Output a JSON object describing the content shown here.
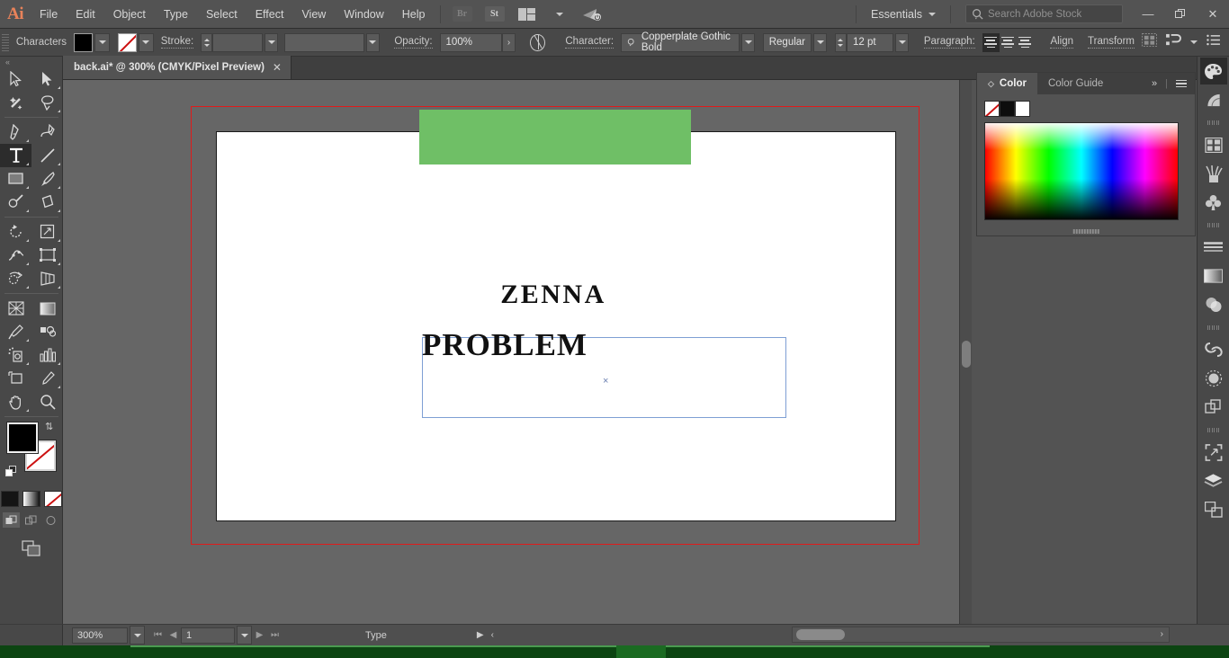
{
  "app": {
    "name": "Adobe Illustrator",
    "logo": "Ai"
  },
  "menubar": {
    "items": [
      {
        "label": "File"
      },
      {
        "label": "Edit"
      },
      {
        "label": "Object"
      },
      {
        "label": "Type"
      },
      {
        "label": "Select"
      },
      {
        "label": "Effect"
      },
      {
        "label": "View"
      },
      {
        "label": "Window"
      },
      {
        "label": "Help"
      }
    ],
    "bridge_label": "Br",
    "stock_label": "St",
    "workspace": "Essentials",
    "search_placeholder": "Search Adobe Stock",
    "window_controls": {
      "minimize": "—",
      "restore": "❐",
      "close": "✕"
    }
  },
  "controlbar": {
    "context_label": "Characters",
    "fill_color": "#000000",
    "stroke_color": "none",
    "stroke_label": "Stroke:",
    "stroke_weight": "",
    "opacity_label": "Opacity:",
    "opacity_value": "100%",
    "character_label": "Character:",
    "font_family": "Copperplate Gothic Bold",
    "font_style": "Regular",
    "font_size": "12 pt",
    "paragraph_label": "Paragraph:",
    "align_label": "Align",
    "transform_label": "Transform"
  },
  "tabs": {
    "documents": [
      {
        "title": "back.ai* @ 300% (CMYK/Pixel Preview)",
        "close": "✕",
        "active": true
      }
    ]
  },
  "tools": {
    "items": [
      {
        "name": "selection-tool",
        "selected": false
      },
      {
        "name": "direct-selection-tool",
        "selected": false
      },
      {
        "name": "magic-wand-tool",
        "selected": false
      },
      {
        "name": "lasso-tool",
        "selected": false
      },
      {
        "name": "pen-tool",
        "selected": false
      },
      {
        "name": "curvature-tool",
        "selected": false
      },
      {
        "name": "type-tool",
        "selected": true
      },
      {
        "name": "line-segment-tool",
        "selected": false
      },
      {
        "name": "rectangle-tool",
        "selected": false
      },
      {
        "name": "paintbrush-tool",
        "selected": false
      },
      {
        "name": "pencil-tool",
        "selected": false
      },
      {
        "name": "eraser-tool",
        "selected": false
      },
      {
        "name": "rotate-tool",
        "selected": false
      },
      {
        "name": "scale-tool",
        "selected": false
      },
      {
        "name": "width-tool",
        "selected": false
      },
      {
        "name": "free-transform-tool",
        "selected": false
      },
      {
        "name": "shape-builder-tool",
        "selected": false
      },
      {
        "name": "perspective-grid-tool",
        "selected": false
      },
      {
        "name": "mesh-tool",
        "selected": false
      },
      {
        "name": "gradient-tool",
        "selected": false
      },
      {
        "name": "eyedropper-tool",
        "selected": false
      },
      {
        "name": "blend-tool",
        "selected": false
      },
      {
        "name": "symbol-sprayer-tool",
        "selected": false
      },
      {
        "name": "column-graph-tool",
        "selected": false
      },
      {
        "name": "artboard-tool",
        "selected": false
      },
      {
        "name": "slice-tool",
        "selected": false
      },
      {
        "name": "hand-tool",
        "selected": false
      },
      {
        "name": "zoom-tool",
        "selected": false
      }
    ],
    "fill_color": "#000000",
    "stroke_color": "none"
  },
  "canvas": {
    "artboard_background": "#ffffff",
    "bleed_color": "#e01b1b",
    "shapes": [
      {
        "name": "green-rectangle-top",
        "color": "#6fbf66"
      },
      {
        "name": "green-rectangle-bottom",
        "color": "#6fbf66"
      }
    ],
    "texts": [
      {
        "name": "heading-zenna",
        "value": "ZENNA"
      },
      {
        "name": "heading-problem",
        "value": "PROBLEM"
      }
    ]
  },
  "color_panel": {
    "tabs": [
      {
        "label": "Color",
        "active": true
      },
      {
        "label": "Color Guide",
        "active": false
      }
    ],
    "collapse_label": "»",
    "swatches": [
      {
        "name": "none-swatch",
        "color": "none"
      },
      {
        "name": "black-swatch",
        "color": "#0d0d0d"
      },
      {
        "name": "white-swatch",
        "color": "#ffffff"
      }
    ]
  },
  "right_dock": {
    "items": [
      {
        "name": "color-panel-icon",
        "active": true
      },
      {
        "name": "color-guide-panel-icon",
        "active": false
      },
      {
        "name": "artboards-panel-icon",
        "active": false
      },
      {
        "name": "brushes-panel-icon",
        "active": false
      },
      {
        "name": "symbols-panel-icon",
        "active": false
      },
      {
        "name": "stroke-panel-icon",
        "active": false
      },
      {
        "name": "gradient-panel-icon",
        "active": false
      },
      {
        "name": "transparency-panel-icon",
        "active": false
      },
      {
        "name": "libraries-panel-icon",
        "active": false
      },
      {
        "name": "appearance-panel-icon",
        "active": false
      },
      {
        "name": "pathfinder-panel-icon",
        "active": false
      },
      {
        "name": "asset-export-panel-icon",
        "active": false
      },
      {
        "name": "layers-panel-icon",
        "active": false
      },
      {
        "name": "align-panel-icon",
        "active": false
      }
    ]
  },
  "statusbar": {
    "zoom_level": "300%",
    "artboard_number": "1",
    "status_text": "Type"
  }
}
